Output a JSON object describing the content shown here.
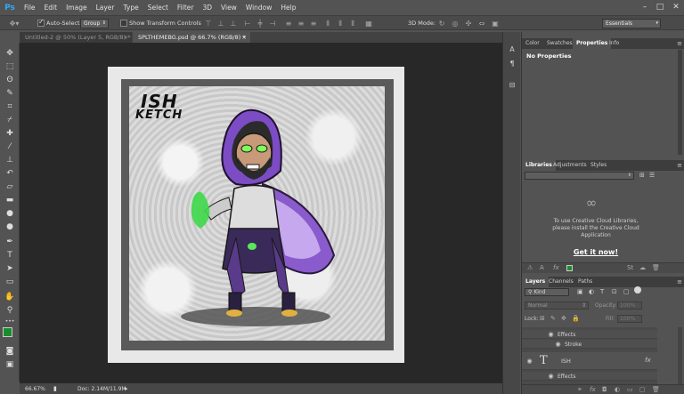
{
  "menu": {
    "logo": "Ps",
    "items": [
      "File",
      "Edit",
      "Image",
      "Layer",
      "Type",
      "Select",
      "Filter",
      "3D",
      "View",
      "Window",
      "Help"
    ]
  },
  "window_controls": {
    "minimize": "–",
    "maximize": "□",
    "close": "✕"
  },
  "options_bar": {
    "auto_select_label": "Auto-Select:",
    "auto_select_value": "Group",
    "transform_label": "Show Transform Controls",
    "mode_3d_label": "3D Mode:",
    "workspace": "Essentials"
  },
  "tabs": [
    {
      "label": "Untitled-2 @ 50% (Layer 5, RGB/8) *",
      "close": "×"
    },
    {
      "label": "SPLTHEMEBG.psd @ 66.7% (RGB/8) *",
      "close": "×"
    }
  ],
  "artwork": {
    "line1": "ISH",
    "line2": "KETCH"
  },
  "status": {
    "zoom": "66.67%",
    "doc": "Doc: 2.14M/11.9M"
  },
  "properties_panel": {
    "tabs": [
      "Color",
      "Swatches",
      "Properties",
      "Info"
    ],
    "active_tab": "Properties",
    "content": "No Properties"
  },
  "libraries_panel": {
    "tabs": [
      "Libraries",
      "Adjustments",
      "Styles"
    ],
    "message": "To use Creative Cloud Libraries, please install the Creative Cloud Application",
    "link": "Get it now!"
  },
  "layers_panel": {
    "tabs": [
      "Layers",
      "Channels",
      "Paths"
    ],
    "filter_kind": "Kind",
    "blend_mode": "Normal",
    "opacity_label": "Opacity:",
    "opacity_value": "100%",
    "lock_label": "Lock:",
    "fill_label": "Fill:",
    "fill_value": "100%",
    "rows": [
      {
        "name": "Effects"
      },
      {
        "name": "Stroke"
      },
      {
        "name": "ISH",
        "type": "T"
      },
      {
        "name": "Effects"
      }
    ]
  },
  "colors": {
    "foreground": "#1a8c2e",
    "background": "#ffffff",
    "accent": "#31a8ff"
  }
}
